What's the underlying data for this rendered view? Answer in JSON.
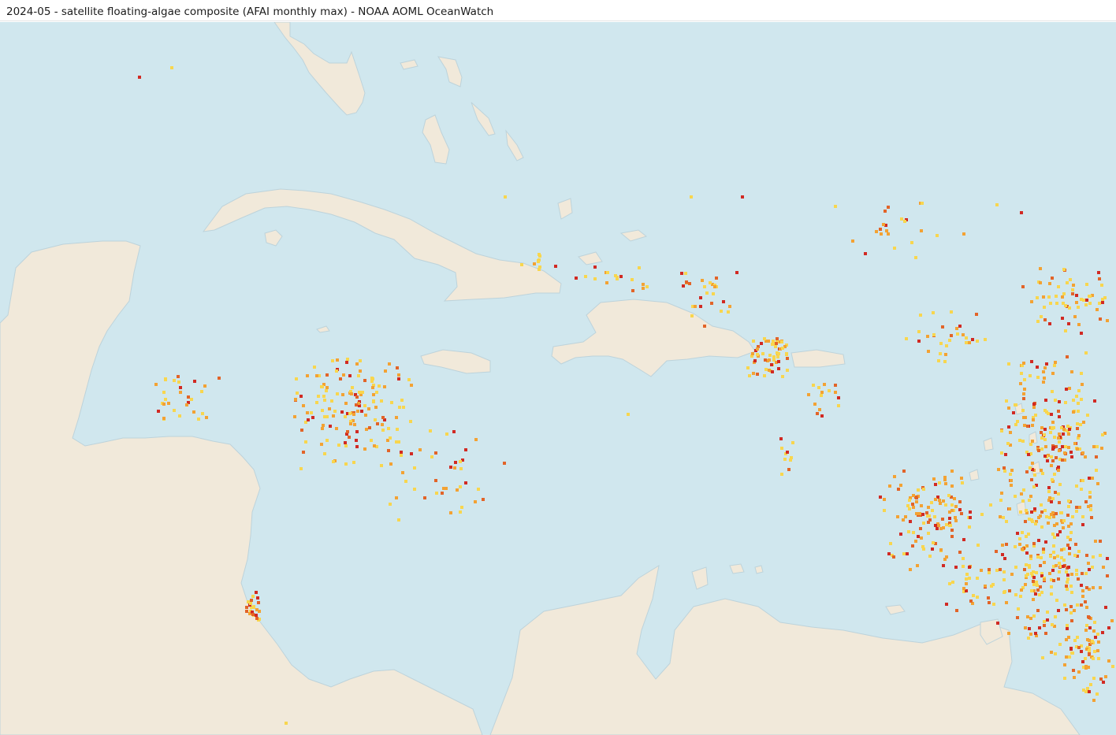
{
  "title": "2024-05 - satellite floating-algae composite (AFAI monthly max) - NOAA AOML OceanWatch",
  "colors": {
    "ocean": "#d0e7ee",
    "land": "#f1e9da",
    "coast": "#bdd3db",
    "low": "#f8d64e",
    "mid": "#f3a233",
    "high": "#e26428",
    "max": "#d12a23"
  },
  "landmasses": [
    "florida",
    "cuba",
    "isla-de-la-juventud",
    "yucatan-central-america",
    "jamaica",
    "hispaniola",
    "puerto-rico",
    "bahamas",
    "cayman-islands",
    "south-america",
    "trinidad",
    "lesser-antilles"
  ],
  "concentration_levels": [
    "low",
    "mid",
    "high",
    "max"
  ]
}
